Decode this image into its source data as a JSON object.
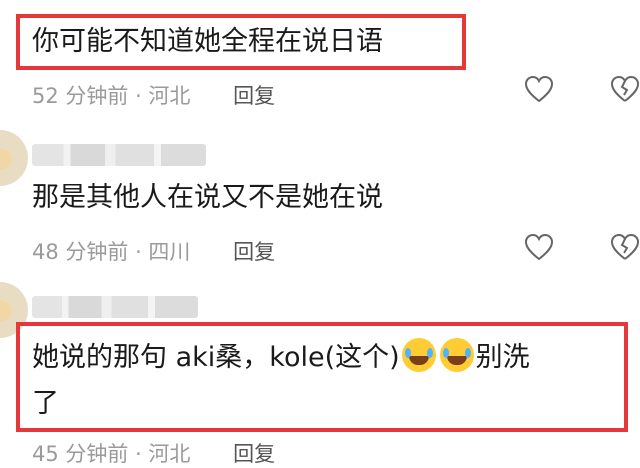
{
  "comments": [
    {
      "text": "你可能不知道她全程在说日语",
      "time": "52 分钟前 · 河北",
      "reply_label": "回复"
    },
    {
      "text": "那是其他人在说又不是她在说",
      "time": "48 分钟前 · 四川",
      "reply_label": "回复"
    },
    {
      "text_part1": "她说的那句  aki桑，kole(这个)",
      "text_part2": "别洗",
      "text_line2": "了",
      "time": "45 分钟前 · 河北",
      "reply_label": "回复"
    }
  ],
  "icons": {
    "like": "heart-outline-icon",
    "dislike": "broken-heart-icon",
    "emoji": "laughing-tears-emoji",
    "highlight_color": "#e5383b"
  }
}
